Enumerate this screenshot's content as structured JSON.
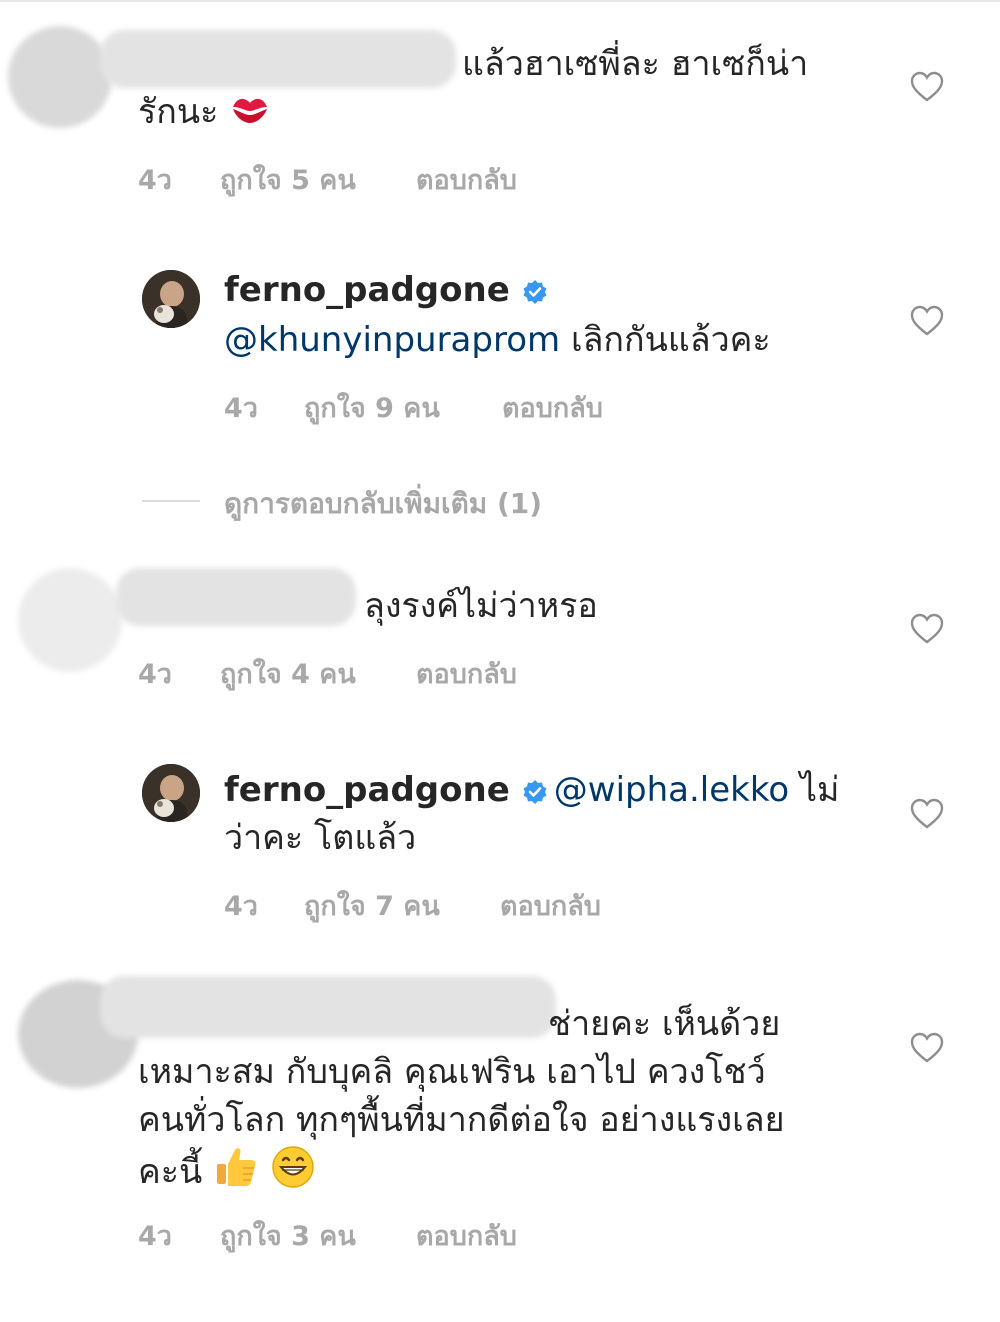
{
  "comments": [
    {
      "text_line1": "แล้วฮาเซพี่ละ ฮาเซก็น่า",
      "text_line2": "รักนะ",
      "emoji": "kiss-mark",
      "time": "4ว",
      "likes": "ถูกใจ 5 คน",
      "reply": "ตอบกลับ"
    },
    {
      "username": "ferno_padgone",
      "mention": "@khunyinpuraprom",
      "text": " เลิกกันแล้วคะ",
      "time": "4ว",
      "likes": "ถูกใจ 9 คน",
      "reply": "ตอบกลับ"
    },
    {
      "view_more": "ดูการตอบกลับเพิ่มเติม (1)"
    },
    {
      "text": "ลุงรงค์ไม่ว่าหรอ",
      "time": "4ว",
      "likes": "ถูกใจ 4 คน",
      "reply": "ตอบกลับ"
    },
    {
      "username": "ferno_padgone",
      "mention": "@wipha.lekko",
      "text_line1": " ไม่",
      "text_line2": "ว่าคะ โตแล้ว",
      "time": "4ว",
      "likes": "ถูกใจ 7 คน",
      "reply": "ตอบกลับ"
    },
    {
      "text_line1": "ช่ายคะ  เห็นด้วย",
      "text_line2": "เหมาะสม กับบุคลิ คุณเฟริน  เอาไป ควงโชว์",
      "text_line3": "คนทั่วโลก ทุกๆพื้นที่มากดีต่อใจ  อย่างแรงเลย",
      "text_line4": "คะนี้",
      "emojis": [
        "thumbs-up",
        "grinning-face"
      ],
      "time": "4ว",
      "likes": "ถูกใจ 3 คน",
      "reply": "ตอบกลับ"
    }
  ],
  "colors": {
    "text": "#262626",
    "meta": "#a8a8a8",
    "mention": "#00376b",
    "verified": "#3897f0",
    "heart_stroke": "#8e8e8e"
  },
  "icons": [
    "heart-icon",
    "verified-badge-icon"
  ]
}
